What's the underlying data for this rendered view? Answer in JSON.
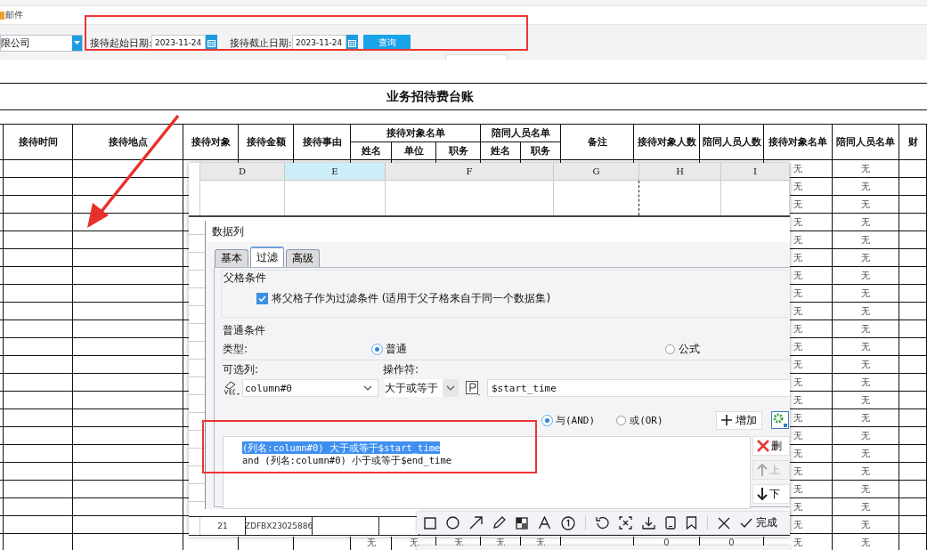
{
  "top_bar": {
    "menu_item": "邮件"
  },
  "filter": {
    "company": "限公司",
    "start_label": "接待起始日期:",
    "start_date": "2023-11-24",
    "end_label": "接待截止日期:",
    "end_date": "2023-11-24",
    "query_button": "查询"
  },
  "report": {
    "title": "业务招待费台账",
    "columns": [
      {
        "label": "接待时间"
      },
      {
        "label": "接待地点"
      },
      {
        "label": "接待对象"
      },
      {
        "label": "接待金额"
      },
      {
        "label": "接待事由"
      },
      {
        "label": "接待对象名单",
        "children": [
          {
            "label": "姓名"
          },
          {
            "label": "单位"
          },
          {
            "label": "职务"
          }
        ]
      },
      {
        "label": "陪同人员名单",
        "children": [
          {
            "label": "姓名"
          },
          {
            "label": "职务"
          }
        ]
      },
      {
        "label": "备注"
      },
      {
        "label": "接待对象人数"
      },
      {
        "label": "陪同人员人数"
      },
      {
        "label": "接待对象名单"
      },
      {
        "label": "陪同人员名单"
      },
      {
        "label": "财"
      }
    ],
    "rows": [
      {
        "kind": "lists",
        "values": [
          "无",
          "无"
        ]
      },
      {
        "kind": "lists",
        "values": [
          "无",
          "无"
        ]
      },
      {
        "kind": "lists",
        "values": [
          "无",
          "无"
        ]
      },
      {
        "kind": "lists",
        "values": [
          "无",
          "无"
        ]
      },
      {
        "kind": "lists",
        "values": [
          "无",
          "无"
        ]
      },
      {
        "kind": "lists",
        "values": [
          "无",
          "无"
        ]
      },
      {
        "kind": "lists",
        "values": [
          "无",
          "无"
        ]
      },
      {
        "kind": "lists",
        "values": [
          "无",
          "无"
        ]
      },
      {
        "kind": "lists",
        "values": [
          "无",
          "无"
        ]
      },
      {
        "kind": "lists",
        "values": [
          "无",
          "无"
        ]
      },
      {
        "kind": "lists",
        "values": [
          "无",
          "无"
        ]
      },
      {
        "kind": "lists",
        "values": [
          "无",
          "无"
        ]
      },
      {
        "kind": "lists",
        "values": [
          "无",
          "无"
        ]
      },
      {
        "kind": "lists",
        "values": [
          "无",
          "无"
        ]
      },
      {
        "kind": "lists",
        "values": [
          "无",
          "无"
        ]
      },
      {
        "kind": "lists",
        "values": [
          "无",
          "无"
        ]
      },
      {
        "kind": "lists",
        "values": [
          "无",
          "无"
        ]
      },
      {
        "kind": "lists",
        "values": [
          "无",
          "无"
        ]
      },
      {
        "kind": "lists",
        "values": [
          "无",
          "无"
        ]
      },
      {
        "kind": "lists",
        "values": [
          "无",
          "无"
        ]
      },
      {
        "kind": "lists",
        "values": [
          "无",
          "无"
        ]
      },
      {
        "kind": "detail",
        "values": [
          "无",
          "无",
          "无",
          "无",
          "无",
          "0",
          "0",
          "无",
          "无"
        ]
      }
    ]
  },
  "sheet": {
    "columns": [
      {
        "label": "D",
        "selected": false
      },
      {
        "label": "E",
        "selected": true
      },
      {
        "label": "F",
        "selected": false
      },
      {
        "label": "G",
        "selected": false
      },
      {
        "label": "H",
        "selected": false
      },
      {
        "label": "I",
        "selected": false
      }
    ],
    "row": {
      "number": "21",
      "cell": "ZDFBX23025886"
    }
  },
  "dialog": {
    "title": "数据列",
    "tabs": [
      {
        "label": "基本",
        "selected": false
      },
      {
        "label": "过滤",
        "selected": true
      },
      {
        "label": "高级",
        "selected": false
      }
    ],
    "parent_section": {
      "title": "父格条件",
      "label": "将父格子作为过滤条件 (适用于父子格来自于同一个数据集)",
      "checked": true
    },
    "normal_section": {
      "title": "普通条件",
      "type_label": "类型:",
      "types": [
        {
          "label": "普通",
          "selected": true
        },
        {
          "label": "公式",
          "selected": false
        }
      ],
      "column_label": "可选列:",
      "operator_label": "操作符:",
      "column": "column#0",
      "operator": "大于或等于",
      "value": "$start_time",
      "joins": [
        {
          "label": "与(AND)",
          "selected": true
        },
        {
          "label": "或(OR)",
          "selected": false
        }
      ],
      "add_button": "增加",
      "conditions": [
        {
          "text": "(列名:column#0) 大于或等于$start_time",
          "selected": true
        },
        {
          "text": "and (列名:column#0) 小于或等于$end_time",
          "selected": false
        }
      ],
      "side_buttons": [
        {
          "kind": "delete",
          "label": "删",
          "disabled": false
        },
        {
          "kind": "up",
          "label": "上",
          "disabled": true
        },
        {
          "kind": "down",
          "label": "下",
          "disabled": false
        }
      ]
    }
  },
  "toolbar": {
    "finish_label": "完成"
  }
}
